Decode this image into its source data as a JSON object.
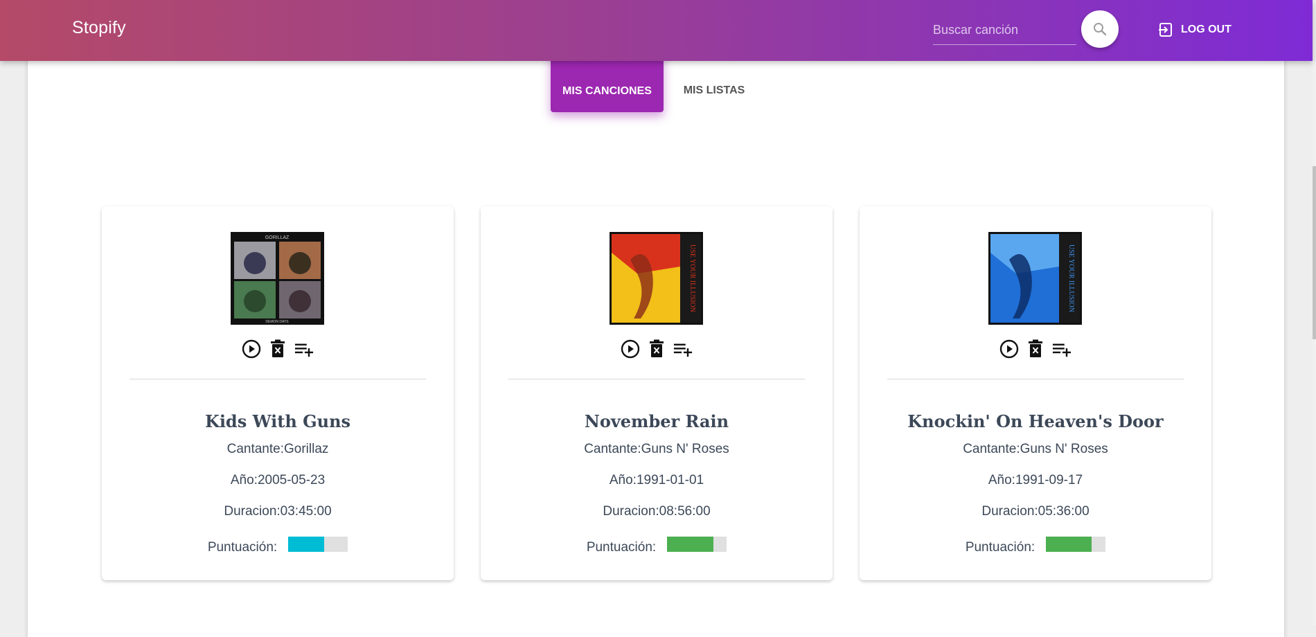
{
  "navbar": {
    "brand": "Stopify",
    "search_placeholder": "Buscar canción",
    "logout_label": "LOG OUT"
  },
  "tabs": {
    "active_label": "MIS CANCIONES",
    "other_label": "MIS LISTAS"
  },
  "songs": [
    {
      "title": "Kids With Guns",
      "singer": "Cantante:Gorillaz",
      "year": "Año:2005-05-23",
      "duration": "Duracion:03:45:00",
      "rating_label": "Puntuación:",
      "rating_fraction": 0.6,
      "rating_color": "#00bcd4",
      "cover": "Demon Days album cover"
    },
    {
      "title": "November Rain",
      "singer": "Cantante:Guns N' Roses",
      "year": "Año:1991-01-01",
      "duration": "Duracion:08:56:00",
      "rating_label": "Puntuación:",
      "rating_fraction": 0.78,
      "rating_color": "#4caf50",
      "cover": "Use Your Illusion I album cover"
    },
    {
      "title": "Knockin' On Heaven's Door",
      "singer": "Cantante:Guns N' Roses",
      "year": "Año:1991-09-17",
      "duration": "Duracion:05:36:00",
      "rating_label": "Puntuación:",
      "rating_fraction": 0.76,
      "rating_color": "#4caf50",
      "cover": "Use Your Illusion II album cover"
    }
  ],
  "colors": {
    "accent": "#9c27b0",
    "text": "#3c4858"
  }
}
